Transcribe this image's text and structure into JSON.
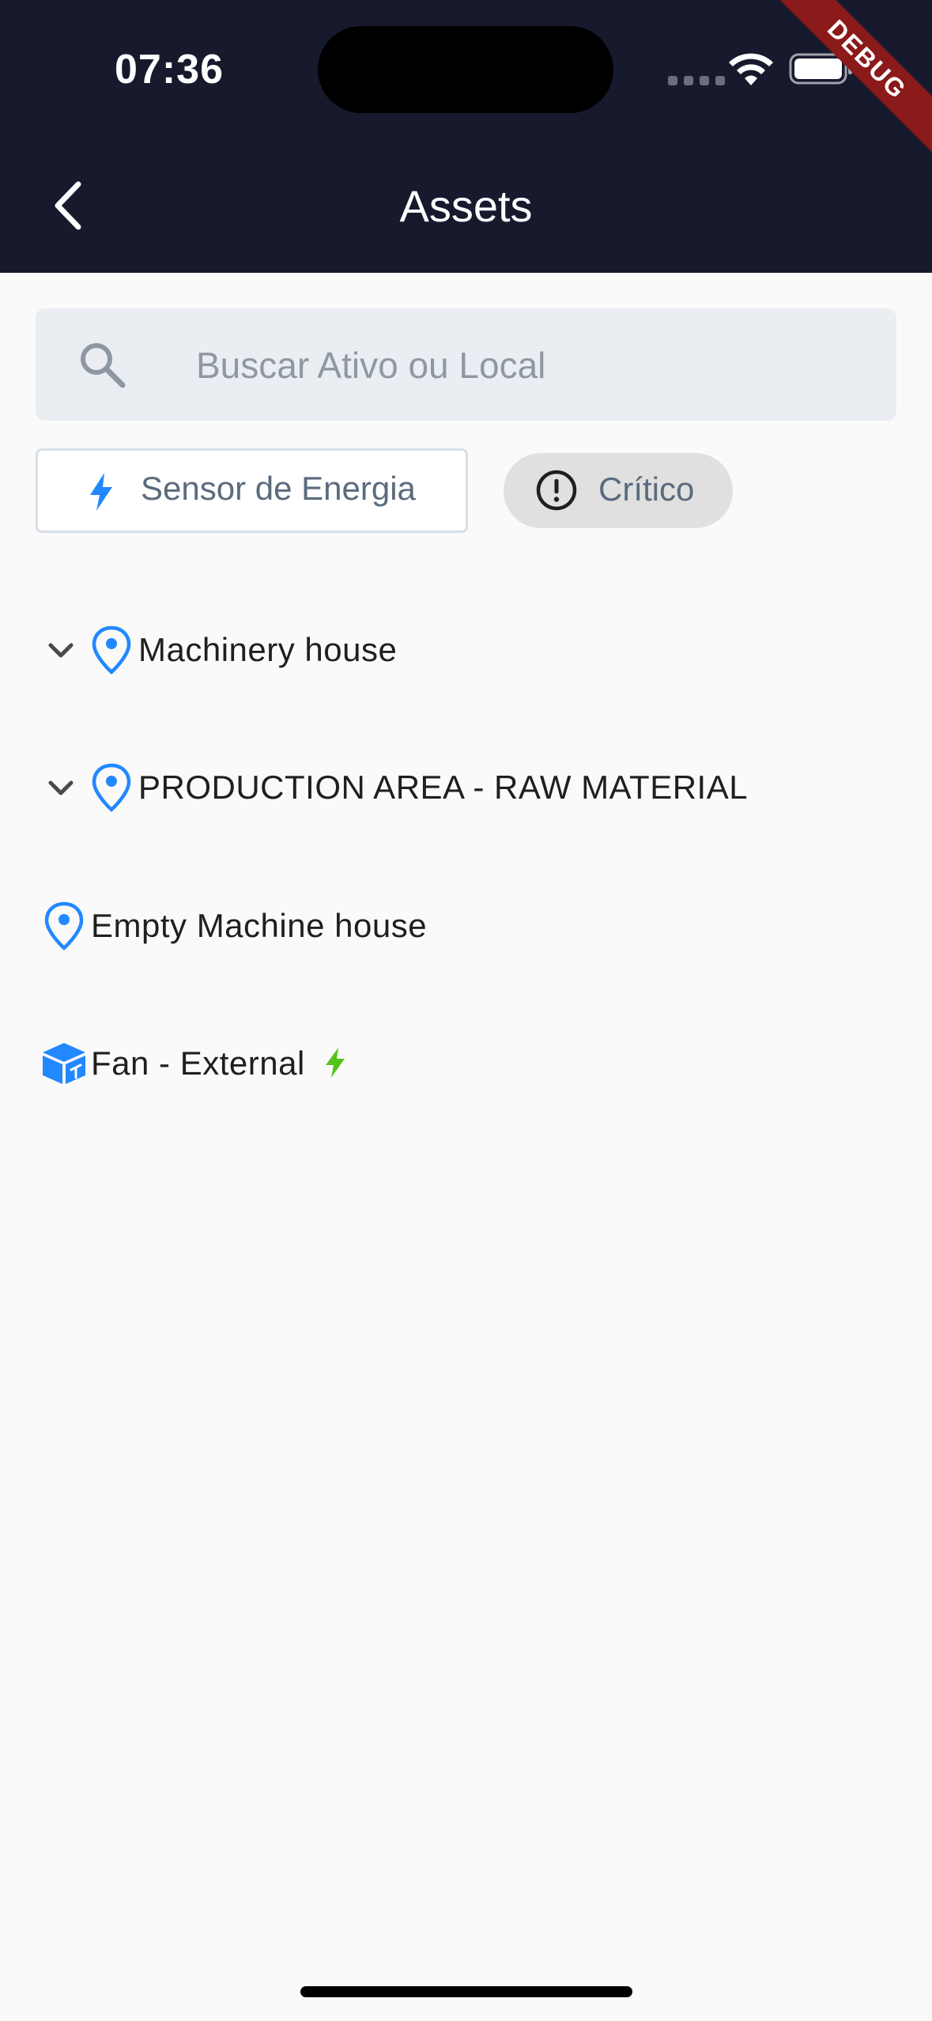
{
  "status_bar": {
    "time": "07:36",
    "debug_label": "DEBUG"
  },
  "header": {
    "title": "Assets"
  },
  "search": {
    "placeholder": "Buscar Ativo ou Local",
    "value": ""
  },
  "filters": {
    "energy_label": "Sensor de Energia",
    "critical_label": "Crítico"
  },
  "tree": [
    {
      "label": "Machinery house",
      "type": "location",
      "expandable": true
    },
    {
      "label": "PRODUCTION AREA - RAW MATERIAL",
      "type": "location",
      "expandable": true
    },
    {
      "label": "Empty Machine house",
      "type": "location",
      "expandable": false
    },
    {
      "label": "Fan - External",
      "type": "asset",
      "expandable": false,
      "sensor": "energy"
    }
  ],
  "colors": {
    "header_bg": "#17192D",
    "accent_blue": "#2188FF",
    "energy_green": "#52C41A",
    "search_bg": "#EAEEF2",
    "debug_red": "#8B1A1A"
  },
  "icons": {
    "back": "chevron-left-icon",
    "search": "search-icon",
    "energy_filter": "bolt-icon",
    "critical_filter": "alert-circle-icon",
    "location": "location-pin-icon",
    "asset": "component-cube-icon",
    "expand": "chevron-down-icon"
  }
}
